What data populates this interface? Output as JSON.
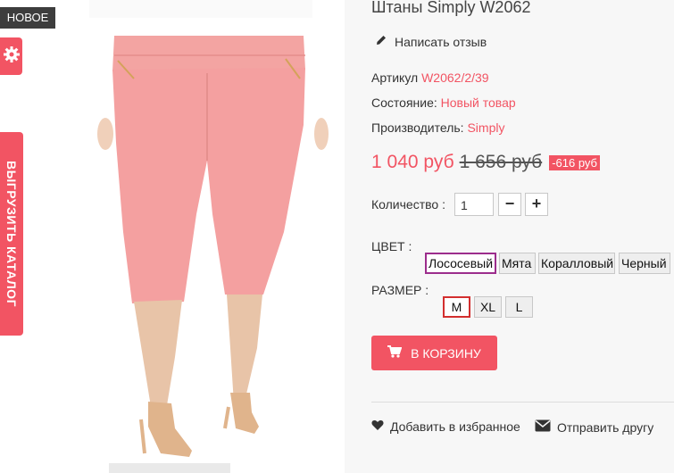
{
  "badge": {
    "new_label": "НОВОЕ"
  },
  "side": {
    "catalog_label": "ВЫГРУЗИТЬ КАТАЛОГ"
  },
  "product": {
    "title": "Штаны Simply W2062",
    "review_label": "Написать отзыв",
    "article_label": "Артикул",
    "article_value": "W2062/2/39",
    "condition_label": "Состояние:",
    "condition_value": "Новый товар",
    "maker_label": "Производитель:",
    "maker_value": "Simply"
  },
  "price": {
    "current": "1 040 руб",
    "old": "1 656 руб",
    "discount": "-616 руб"
  },
  "quantity": {
    "label": "Количество :",
    "value": "1",
    "minus": "−",
    "plus": "+"
  },
  "color": {
    "label": "ЦВЕТ :",
    "options": [
      "Лососевый",
      "Мята",
      "Коралловый",
      "Черный"
    ],
    "selected": "Лососевый"
  },
  "size": {
    "label": "РАЗМЕР :",
    "options": [
      "M",
      "XL",
      "L"
    ],
    "selected": "M"
  },
  "cart": {
    "label": "В КОРЗИНУ"
  },
  "links": {
    "wishlist": "Добавить в избранное",
    "send_friend": "Отправить другу"
  },
  "colors": {
    "accent": "#f25463",
    "pants": "#f4a0a0",
    "skin": "#e8c4a8",
    "shoe": "#e0b48c"
  },
  "icons": {
    "gear": "gear-icon",
    "pencil": "pencil-icon",
    "cart": "cart-icon",
    "heart": "heart-icon",
    "envelope": "envelope-icon"
  }
}
